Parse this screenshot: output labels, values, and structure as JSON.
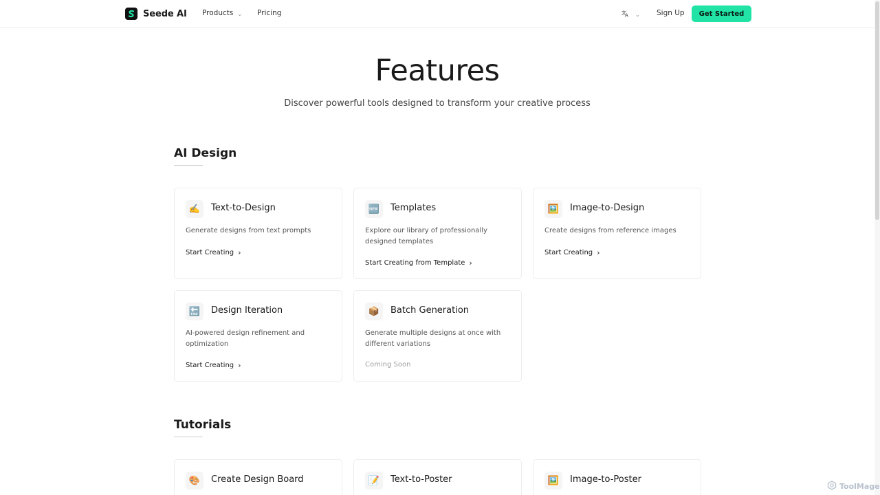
{
  "header": {
    "logo_text": "Seede AI",
    "nav": [
      {
        "label": "Products",
        "has_dropdown": true
      },
      {
        "label": "Pricing",
        "has_dropdown": false
      }
    ],
    "language_icon": "translate-icon",
    "sign_up": "Sign Up",
    "get_started": "Get Started",
    "accent_color": "#20e3a5"
  },
  "hero": {
    "title": "Features",
    "subtitle": "Discover powerful tools designed to transform your creative process"
  },
  "sections": [
    {
      "title": "AI Design",
      "cards": [
        {
          "icon": "✍️",
          "icon_name": "writing-hand-icon",
          "title": "Text-to-Design",
          "description": "Generate designs from text prompts",
          "link": "Start Creating",
          "status": "active"
        },
        {
          "icon": "🆕",
          "icon_name": "new-badge-icon",
          "title": "Templates",
          "description": "Explore our library of professionally designed templates",
          "link": "Start Creating from Template",
          "status": "active"
        },
        {
          "icon": "🖼️",
          "icon_name": "picture-icon",
          "title": "Image-to-Design",
          "description": "Create designs from reference images",
          "link": "Start Creating",
          "status": "active"
        },
        {
          "icon": "🔚",
          "icon_name": "end-arrow-icon",
          "title": "Design Iteration",
          "description": "AI-powered design refinement and optimization",
          "link": "Start Creating",
          "status": "active"
        },
        {
          "icon": "📦",
          "icon_name": "package-icon",
          "title": "Batch Generation",
          "description": "Generate multiple designs at once with different variations",
          "link": "Coming Soon",
          "status": "coming-soon"
        }
      ]
    },
    {
      "title": "Tutorials",
      "cards": [
        {
          "icon": "🎨",
          "icon_name": "palette-icon",
          "title": "Create Design Board"
        },
        {
          "icon": "📝",
          "icon_name": "memo-icon",
          "title": "Text-to-Poster"
        },
        {
          "icon": "🖼️",
          "icon_name": "picture-icon",
          "title": "Image-to-Poster"
        }
      ]
    }
  ],
  "watermark": "ToolMage"
}
